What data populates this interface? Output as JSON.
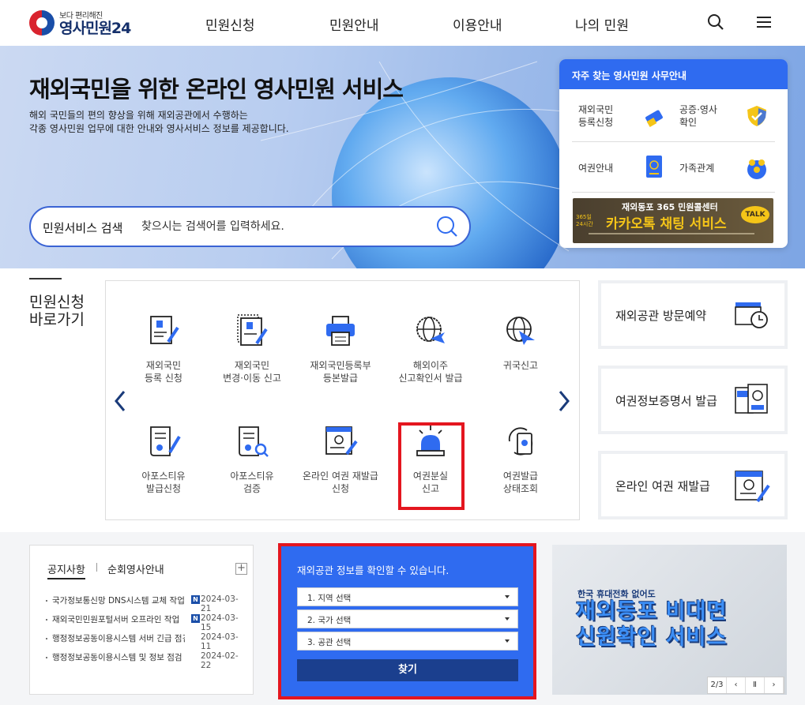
{
  "brand": {
    "tagline": "보다 편리해진",
    "name": "영사민원24"
  },
  "nav": [
    "민원신청",
    "민원안내",
    "이용안내",
    "나의 민원"
  ],
  "hero": {
    "title": "재외국민을 위한 온라인 영사민원 서비스",
    "subtitle_line1": "해외 국민들의 편의 향상을 위해 재외공관에서 수행하는",
    "subtitle_line2": "각종 영사민원 업무에 대한 안내와 영사서비스 정보를 제공합니다."
  },
  "search": {
    "label": "민원서비스 검색",
    "placeholder": "찾으시는 검색어를 입력하세요."
  },
  "faq": {
    "title": "자주 찾는 영사민원 사무안내",
    "items": [
      {
        "l1": "재외국민",
        "l2": "등록신청"
      },
      {
        "l1": "공증·영사",
        "l2": "확인"
      },
      {
        "l1": "여권안내",
        "l2": ""
      },
      {
        "l1": "가족관계",
        "l2": ""
      }
    ],
    "banner_top": "재외동포 365 민원콜센터",
    "banner_main": "카카오톡 채팅 서비스",
    "banner_side1": "365일",
    "banner_side2": "24시간",
    "banner_talk": "TALK"
  },
  "shortcut": {
    "line1": "민원신청",
    "line2": "바로가기"
  },
  "services": [
    {
      "l1": "재외국민",
      "l2": "등록 신청"
    },
    {
      "l1": "재외국민",
      "l2": "변경·이동 신고"
    },
    {
      "l1": "재외국민등록부",
      "l2": "등본발급"
    },
    {
      "l1": "해외이주",
      "l2": "신고확인서 발급"
    },
    {
      "l1": "귀국신고",
      "l2": ""
    },
    {
      "l1": "아포스티유",
      "l2": "발급신청"
    },
    {
      "l1": "아포스티유",
      "l2": "검증"
    },
    {
      "l1": "온라인 여권 재발급",
      "l2": "신청"
    },
    {
      "l1": "여권분실",
      "l2": "신고"
    },
    {
      "l1": "여권발급",
      "l2": "상태조회"
    }
  ],
  "side_cards": [
    "재외공관 방문예약",
    "여권정보증명서 발급",
    "온라인 여권 재발급"
  ],
  "notice": {
    "tab_active": "공지사항",
    "tab_other": "순회영사안내",
    "plus": "+",
    "rows": [
      {
        "title": "국가정보통신망 DNS시스템 교체 작업",
        "new": "N",
        "date": "2024-03-21"
      },
      {
        "title": "재외국민민원포털서버 오프라인 작업",
        "new": "N",
        "date": "2024-03-15"
      },
      {
        "title": "행정정보공동이용시스템 서버 긴급 점검",
        "new": "",
        "date": "2024-03-11"
      },
      {
        "title": "행정정보공동이용시스템 및 정보 점검",
        "new": "",
        "date": "2024-02-22"
      }
    ]
  },
  "finder": {
    "title": "재외공관 정보를 확인할 수 있습니다.",
    "selects": [
      "1. 지역 선택",
      "2. 국가 선택",
      "3. 공관 선택"
    ],
    "button": "찾기"
  },
  "promo": {
    "small": "한국 휴대전화 없어도",
    "line1": "재외동포 비대면",
    "line2": "신원확인 서비스",
    "page": "2/3",
    "prev": "‹",
    "pause": "Ⅱ",
    "next": "›"
  },
  "colors": {
    "accent": "#2f6bf0",
    "highlight": "#e4161f",
    "navy": "#1b3f8e"
  }
}
